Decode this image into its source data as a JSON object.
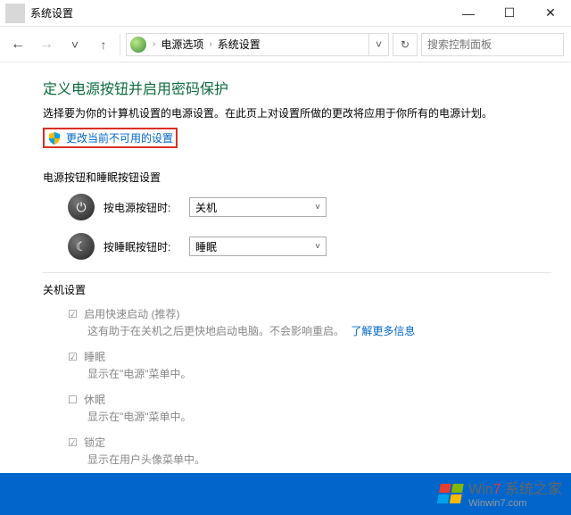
{
  "window": {
    "title": "系统设置",
    "min": "—",
    "max": "☐",
    "close": "✕"
  },
  "breadcrumb": {
    "item1": "电源选项",
    "item2": "系统设置"
  },
  "search": {
    "placeholder": "搜索控制面板"
  },
  "page": {
    "title": "定义电源按钮并启用密码保护",
    "desc": "选择要为你的计算机设置的电源设置。在此页上对设置所做的更改将应用于你所有的电源计划。",
    "admin_link": "更改当前不可用的设置"
  },
  "section1": {
    "title": "电源按钮和睡眠按钮设置",
    "power_label": "按电源按钮时:",
    "power_value": "关机",
    "sleep_label": "按睡眠按钮时:",
    "sleep_value": "睡眠"
  },
  "section2": {
    "title": "关机设置",
    "opt1": {
      "label": "启用快速启动 (推荐)",
      "sub": "这有助于在关机之后更快地启动电脑。不会影响重启。",
      "link": "了解更多信息"
    },
    "opt2": {
      "label": "睡眠",
      "sub": "显示在\"电源\"菜单中。"
    },
    "opt3": {
      "label": "休眠",
      "sub": "显示在\"电源\"菜单中。"
    },
    "opt4": {
      "label": "锁定",
      "sub": "显示在用户头像菜单中。"
    }
  },
  "watermark": {
    "text1": "Win",
    "text2": "系统之家",
    "text3": "Winwin7.com"
  }
}
